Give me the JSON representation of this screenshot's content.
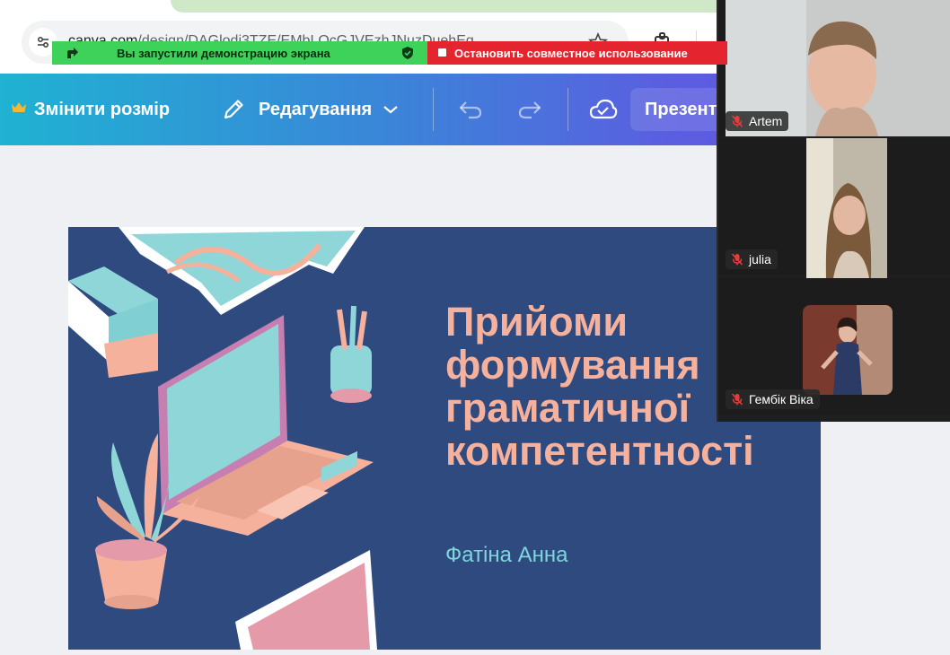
{
  "browser": {
    "url_host": "canva.com",
    "url_path": "/design/DAGlodi3TZE/EMbLQcGJVEzhJNuzDuehEg..."
  },
  "share_banner": {
    "status_text": "Вы запустили демонстрацию экрана",
    "stop_text": "Остановить совместное использование"
  },
  "toolbar": {
    "resize_label": "Змінити розмір",
    "edit_label": "Редагування",
    "present_label": "Презентувати"
  },
  "slide": {
    "title_lines": [
      "Прийоми",
      "формування",
      "граматичної",
      "компетентності"
    ],
    "author": "Фатіна Анна"
  },
  "participants": [
    {
      "name": "Artem",
      "muted": true
    },
    {
      "name": "julia",
      "muted": true
    },
    {
      "name": "Гембік Віка",
      "muted": true
    }
  ],
  "colors": {
    "slide_bg": "#2f4a7f",
    "title": "#f5b19c",
    "author": "#7ed6dc",
    "share_green": "#3fd25a",
    "share_red": "#e4252f"
  }
}
